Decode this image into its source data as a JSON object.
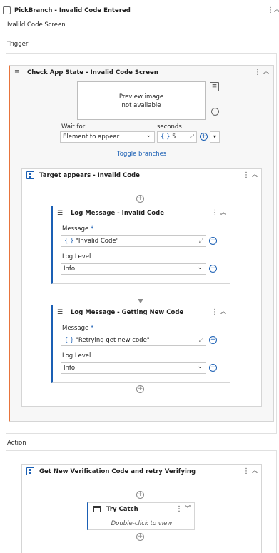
{
  "pickbranch": {
    "title": "PickBranch - Invalid Code Entered",
    "subtitle": "Ivalild Code Screen"
  },
  "trigger": {
    "label": "Trigger"
  },
  "check_app_state": {
    "title": "Check App State - Invalid Code Screen",
    "preview_text": "Preview image\nnot available",
    "wait_for_label": "Wait for",
    "wait_for_value": "Element to appear",
    "seconds_label": "seconds",
    "seconds_value": "5",
    "toggle_branches": "Toggle branches"
  },
  "target_appears": {
    "title": "Target appears - Invalid Code"
  },
  "log1": {
    "title": "Log Message - Invalid Code",
    "message_label": "Message",
    "message_value": "\"Invalid Code\"",
    "level_label": "Log Level",
    "level_value": "Info"
  },
  "log2": {
    "title": "Log Message - Getting New Code",
    "message_label": "Message",
    "message_value": "\"Retrying  get new code\"",
    "level_label": "Log Level",
    "level_value": "Info"
  },
  "action": {
    "label": "Action"
  },
  "get_new_code": {
    "title": "Get New Verification Code and retry Verifying"
  },
  "try_catch": {
    "title": "Try Catch",
    "hint": "Double-click to view"
  },
  "glyphs": {
    "required": "*",
    "brace": "{ }",
    "kebab": "⋮",
    "collapse": "︽",
    "expand": "︾",
    "plus": "+",
    "dropdown": "▾",
    "chevron": "⌄"
  },
  "colors": {
    "accent_orange": "#e8743b",
    "link_blue": "#1a5fb4"
  }
}
